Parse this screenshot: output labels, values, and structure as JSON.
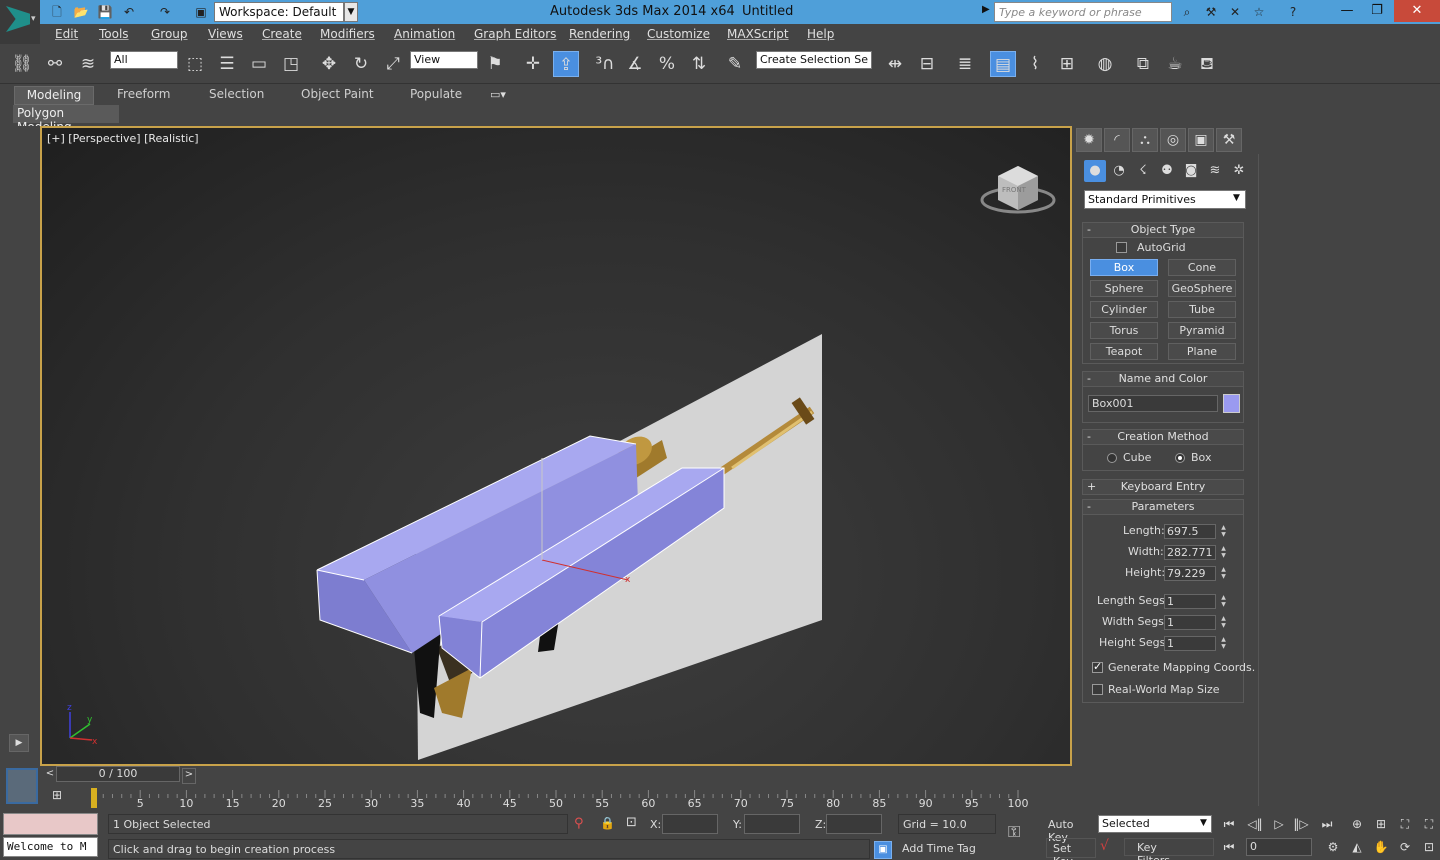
{
  "titlebar": {
    "workspace": "Workspace: Default",
    "app_title": "Autodesk 3ds Max  2014 x64",
    "doc_title": "Untitled",
    "search_placeholder": "Type a keyword or phrase"
  },
  "menu": [
    "Edit",
    "Tools",
    "Group",
    "Views",
    "Create",
    "Modifiers",
    "Animation",
    "Graph Editors",
    "Rendering",
    "Customize",
    "MAXScript",
    "Help"
  ],
  "toolbar": {
    "selection_filter": "All",
    "reference_coord": "View",
    "named_selection": "Create Selection Se"
  },
  "ribbon": {
    "tabs": [
      "Modeling",
      "Freeform",
      "Selection",
      "Object Paint",
      "Populate"
    ],
    "panel": "Polygon Modeling"
  },
  "viewport": {
    "label": "[+] [Perspective] [Realistic]",
    "viewcube_label": "FRONT",
    "box_color": "#8a8ad8",
    "plane_color": "#d4d4d4",
    "frame_color": "#c8a24a"
  },
  "command_panel": {
    "dropdown": "Standard Primitives",
    "object_type": {
      "title": "Object Type",
      "autogrid": "AutoGrid",
      "buttons": [
        "Box",
        "Cone",
        "Sphere",
        "GeoSphere",
        "Cylinder",
        "Tube",
        "Torus",
        "Pyramid",
        "Teapot",
        "Plane"
      ],
      "active": "Box"
    },
    "name_color": {
      "title": "Name and Color",
      "name": "Box001",
      "swatch": "#9a9af0"
    },
    "creation_method": {
      "title": "Creation Method",
      "cube": "Cube",
      "box": "Box"
    },
    "keyboard_entry": {
      "title": "Keyboard Entry"
    },
    "parameters": {
      "title": "Parameters",
      "length_label": "Length:",
      "length": "697.5",
      "width_label": "Width:",
      "width": "282.771",
      "height_label": "Height:",
      "height": "79.229",
      "length_segs_label": "Length Segs:",
      "length_segs": "1",
      "width_segs_label": "Width Segs:",
      "width_segs": "1",
      "height_segs_label": "Height Segs:",
      "height_segs": "1",
      "gen_mapping": "Generate Mapping Coords.",
      "real_world": "Real-World Map Size"
    }
  },
  "timeline": {
    "slider": "0 / 100",
    "ticks": [
      "5",
      "10",
      "15",
      "20",
      "25",
      "30",
      "35",
      "40",
      "45",
      "50",
      "55",
      "60",
      "65",
      "70",
      "75",
      "80",
      "85",
      "90",
      "95",
      "100"
    ]
  },
  "status": {
    "maxscript": "Welcome to M",
    "selected": "1 Object Selected",
    "prompt": "Click and drag to begin creation process",
    "x": "X:",
    "y": "Y:",
    "z": "Z:",
    "grid": "Grid = 10.0",
    "add_time_tag": "Add Time Tag",
    "auto_key": "Auto Key",
    "set_key": "Set Key",
    "selected_dropdown": "Selected",
    "key_filters": "Key Filters...",
    "frame": "0"
  }
}
